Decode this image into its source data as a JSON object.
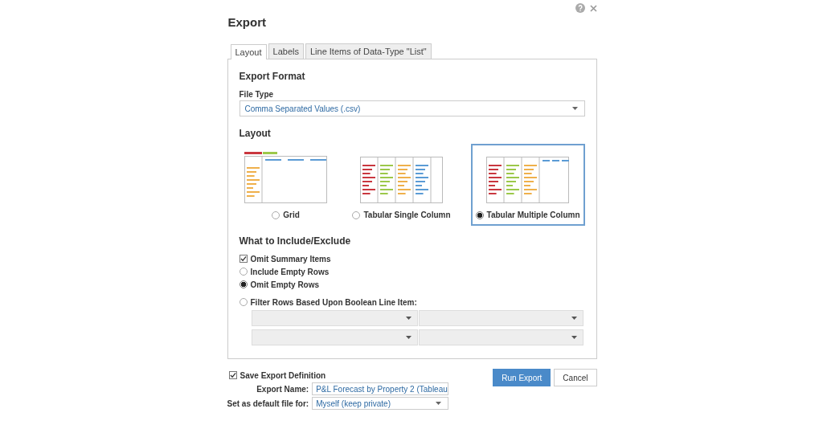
{
  "dialog": {
    "title": "Export"
  },
  "tabs": [
    {
      "label": "Layout",
      "selected": true
    },
    {
      "label": "Labels",
      "selected": false
    },
    {
      "label": "Line Items of Data-Type \"List\"",
      "selected": false
    }
  ],
  "export_format": {
    "heading": "Export Format",
    "file_type_label": "File Type",
    "file_type_value": "Comma Separated Values (.csv)"
  },
  "layout": {
    "heading": "Layout",
    "options": [
      {
        "kind": "grid",
        "label": "Grid",
        "selected": false
      },
      {
        "kind": "tabular-single",
        "label": "Tabular Single Column",
        "selected": false
      },
      {
        "kind": "tabular-multiple",
        "label": "Tabular Multiple Column",
        "selected": true
      }
    ]
  },
  "include": {
    "heading": "What to Include/Exclude",
    "items": [
      {
        "kind": "checkbox",
        "label": "Omit Summary Items",
        "checked": true
      },
      {
        "kind": "radio",
        "label": "Include Empty Rows",
        "selected": false
      },
      {
        "kind": "radio",
        "label": "Omit Empty Rows",
        "selected": true
      },
      {
        "kind": "radio",
        "label": "Filter Rows Based Upon Boolean Line Item:",
        "selected": false
      }
    ],
    "filter_dropdowns": [
      {
        "disabled": true
      },
      {
        "disabled": true
      },
      {
        "disabled": true
      },
      {
        "disabled": true
      }
    ]
  },
  "footer": {
    "save_definition": {
      "label": "Save Export Definition",
      "checked": true
    },
    "export_name_label": "Export Name:",
    "export_name_value": "P&L Forecast by Property 2 (Tableau",
    "default_for_label": "Set as default file for:",
    "default_for_value": "Myself (keep private)",
    "buttons": [
      {
        "kind": "primary",
        "label": "Run Export"
      },
      {
        "kind": "secondary",
        "label": "Cancel"
      }
    ]
  }
}
